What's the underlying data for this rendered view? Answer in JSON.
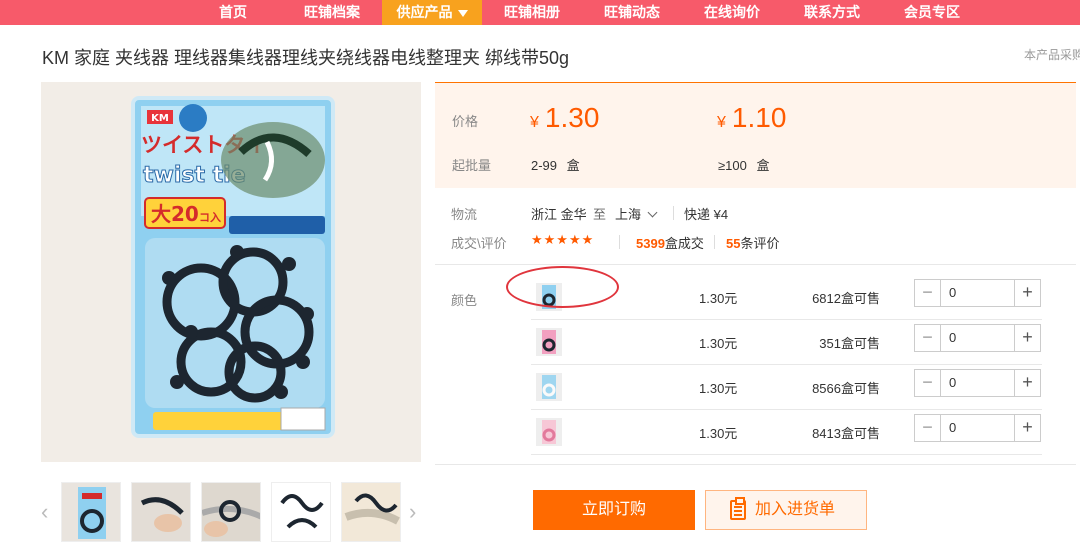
{
  "nav": {
    "items": [
      "首页",
      "旺铺档案",
      "供应产品",
      "旺铺相册",
      "旺铺动态",
      "在线询价",
      "联系方式",
      "会员专区"
    ],
    "active_index": 2,
    "active_color": "#f8a21e",
    "bar_color": "#f75a6a"
  },
  "product": {
    "title": "KM 家庭 夹线器 理线器集线器理线夹绕线器电线整理夹 绑线带50g",
    "right_note": "本产品采购"
  },
  "pricing": {
    "price_label": "价格",
    "currency": "¥",
    "tiers": [
      {
        "price": "1.30",
        "range": "2-99",
        "unit": "盒"
      },
      {
        "price": "1.10",
        "range": "≥100",
        "unit": "盒"
      }
    ],
    "moq_label": "起批量"
  },
  "logistics": {
    "label": "物流",
    "from": "浙江 金华",
    "to_word": "至",
    "to": "上海",
    "express": "快递 ¥4"
  },
  "deals": {
    "label": "成交\\评价",
    "rating_stars": 5,
    "stars_text": "★★★★★",
    "sold_count": "5399",
    "sold_suffix": "盒成交",
    "review_count": "55",
    "review_suffix": "条评价"
  },
  "sku": {
    "label": "颜色",
    "rows": [
      {
        "price": "1.30元",
        "stock": "6812",
        "stock_suffix": "盒可售",
        "qty": "0"
      },
      {
        "price": "1.30元",
        "stock": "351",
        "stock_suffix": "盒可售",
        "qty": "0"
      },
      {
        "price": "1.30元",
        "stock": "8566",
        "stock_suffix": "盒可售",
        "qty": "0"
      },
      {
        "price": "1.30元",
        "stock": "8413",
        "stock_suffix": "盒可售",
        "qty": "0"
      }
    ]
  },
  "actions": {
    "buy_now": "立即订购",
    "add_to_list": "加入进货单"
  },
  "accent_color": "#ff6a00",
  "annotation_color": "#e0353d",
  "package_text": {
    "brand": "KM",
    "jp_title": "ツイストタイ",
    "en_title": "twist tie",
    "count": "大20",
    "count_unit": "コ入"
  }
}
